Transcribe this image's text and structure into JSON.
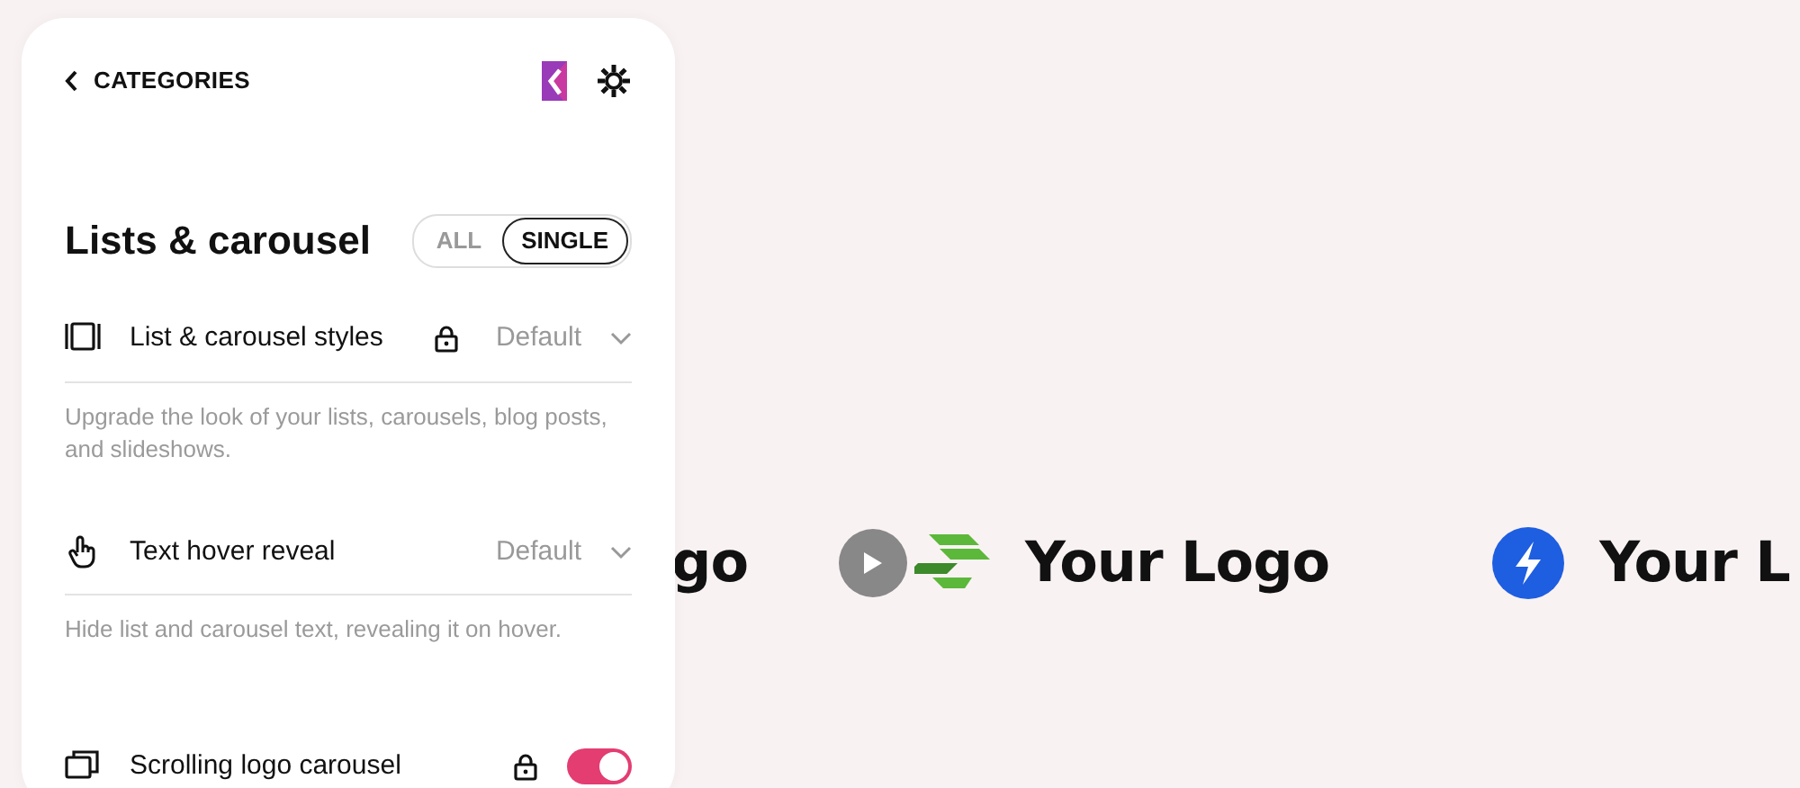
{
  "header": {
    "back_label": "CATEGORIES"
  },
  "section": {
    "title": "Lists & carousel",
    "filters": [
      {
        "label": "ALL",
        "selected": false
      },
      {
        "label": "SINGLE",
        "selected": true
      }
    ]
  },
  "settings": [
    {
      "kind": "select",
      "label": "List & carousel styles",
      "locked": true,
      "value": "Default",
      "description": "Upgrade the look of your lists, carousels, blog posts, and slideshows."
    },
    {
      "kind": "select",
      "label": "Text hover reveal",
      "locked": false,
      "value": "Default",
      "description": "Hide list and carousel text, revealing it on hover."
    },
    {
      "kind": "toggle",
      "label": "Scrolling logo carousel",
      "locked": true,
      "on": true
    }
  ],
  "carousel": {
    "logos": [
      {
        "kind": "text",
        "text": "go"
      },
      {
        "kind": "stripes",
        "text": "Your Logo"
      },
      {
        "kind": "bolt",
        "text": "Your L"
      }
    ]
  }
}
